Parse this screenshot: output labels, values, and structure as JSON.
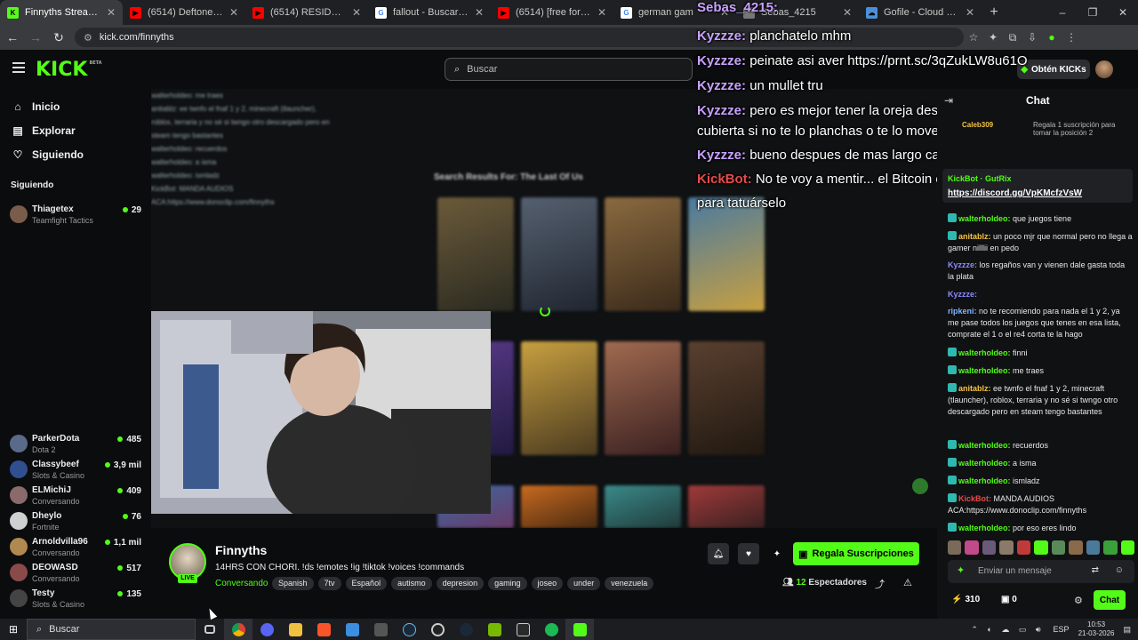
{
  "browser": {
    "tabs": [
      {
        "title": "Finnyths Stream - Watch L",
        "color": "#53fc18",
        "glyph": "K",
        "active": true
      },
      {
        "title": "(6514) Deftones – Risk (O",
        "color": "#ff0000",
        "glyph": "▶",
        "active": false
      },
      {
        "title": "(6514) RESIDENT EVIL RE",
        "color": "#ff0000",
        "glyph": "▶",
        "active": false
      },
      {
        "title": "fallout - Buscar con Goog",
        "color": "#ffffff",
        "glyph": "G",
        "active": false
      },
      {
        "title": "(6514) [free for profit] alt",
        "color": "#ff0000",
        "glyph": "▶",
        "active": false
      },
      {
        "title": "german gam",
        "color": "#ffffff",
        "glyph": "G",
        "active": false
      },
      {
        "title": "Sebas_4215",
        "color": "#777777",
        "glyph": "",
        "active": false
      },
      {
        "title": "Gofile - Cloud Storage M",
        "color": "#4a90d9",
        "glyph": "☁",
        "active": false
      }
    ],
    "url": "kick.com/finnyths"
  },
  "kick": {
    "logo": "KICK",
    "logo_badge": "BETA",
    "search_placeholder": "Buscar",
    "kicks_button": "Obtén KICKs"
  },
  "sidebar": {
    "nav": [
      {
        "label": "Inicio",
        "icon": "⌂"
      },
      {
        "label": "Explorar",
        "icon": "▤"
      },
      {
        "label": "Siguiendo",
        "icon": "♡"
      }
    ],
    "following_heading": "Siguiendo",
    "channels": [
      {
        "name": "Thiagetex",
        "category": "Teamfight Tactics",
        "viewers": "29",
        "color": "#7a5c4a"
      },
      {
        "name": "ParkerDota",
        "category": "Dota 2",
        "viewers": "485",
        "color": "#5a6a8a"
      },
      {
        "name": "Classybeef",
        "category": "Slots & Casino",
        "viewers": "3,9 mil",
        "color": "#2f4f8f"
      },
      {
        "name": "ELMichiJ",
        "category": "Conversando",
        "viewers": "409",
        "color": "#8a6a6a"
      },
      {
        "name": "Dheylo",
        "category": "Fortnite",
        "viewers": "76",
        "color": "#d0d0d0"
      },
      {
        "name": "Arnoldvilla96",
        "category": "Conversando",
        "viewers": "1,1 mil",
        "color": "#b08850"
      },
      {
        "name": "DEOWASD",
        "category": "Conversando",
        "viewers": "517",
        "color": "#8a4a4a"
      },
      {
        "name": "Testy",
        "category": "Slots & Casino",
        "viewers": "135",
        "color": "#444444"
      }
    ]
  },
  "video": {
    "shop_heading": "Search Results For: The Last Of Us",
    "blur_chat": [
      "walterholdeo: me traes",
      "anitablz: ee twnfo el fnaf 1 y 2, minecraft (tlauncher),",
      "roblox, terraria y no sé si twngo otro descargado pero en",
      "steam tengo bastantes",
      "walterholdeo: recuerdos",
      "walterholdeo: a isma",
      "walterholdeo: ismladz",
      "KickBot: MANDA AUDIOS",
      "ACA:https://www.donoclip.com/finnyths"
    ],
    "overlay_chat": [
      {
        "user": "Sebas_4215:",
        "text": ""
      },
      {
        "user": "Kyzzze:",
        "text": "planchatelo mhm"
      },
      {
        "user": "Kyzzze:",
        "text": "peinate asi aver https://prnt.sc/3qZukLW8u61O"
      },
      {
        "user": "Kyzzze:",
        "text": "un mullet tru"
      },
      {
        "user": "Kyzzze:",
        "text": "pero es mejor tener la oreja descubierta, asi"
      },
      {
        "user": "",
        "text": "cubierta si no te lo planchas o te lo moves ve raro"
      },
      {
        "user": "Kyzzze:",
        "text": "bueno despues de mas largo capaz q si"
      },
      {
        "user": "KickBot:",
        "text": "No te voy a mentir... el Bitcoin está"
      },
      {
        "user": "",
        "text": "para tatuárselo"
      }
    ]
  },
  "stream": {
    "live_label": "LIVE",
    "name": "Finnyths",
    "title": "14HRS CON CHORI. !ds !emotes !ig !tiktok !voices !commands",
    "category": "Conversando",
    "tags": [
      "Spanish",
      "7tv",
      "Español",
      "autismo",
      "depresion",
      "gaming",
      "joseo",
      "under",
      "venezuela"
    ],
    "gift_button": "Regala Suscripciones",
    "viewer_count": "12",
    "viewer_label": "Espectadores"
  },
  "chat": {
    "title": "Chat",
    "gift_prompt": "Regala 1 suscripción para tomar la posición 2",
    "gifter": "Caleb309",
    "pinned_by": "KickBot · GutRix",
    "pinned_link": "https://discord.gg/VpKMcfzVsW",
    "messages": [
      {
        "user": "walterholdeo:",
        "text": "que juegos tiene",
        "color": "#53fc18"
      },
      {
        "user": "anitablz:",
        "text": "un poco mjr que normal pero no llega a gamer nilllii en pedo",
        "color": "#f5c542"
      },
      {
        "user": "Kyzzze:",
        "text": "los regaños van y vienen dale gasta toda la plata",
        "color": "#8e8bff"
      },
      {
        "user": "Kyzzze:",
        "text": "",
        "color": "#8e8bff"
      },
      {
        "user": "ripkeni:",
        "text": "no te recomiendo para nada el 1 y 2, ya me pase todos los juegos que tenes en esa lista, comprate el 1 o el re4 corta te la hago",
        "color": "#7fb4ff"
      },
      {
        "user": "walterholdeo:",
        "text": "finni",
        "color": "#53fc18"
      },
      {
        "user": "walterholdeo:",
        "text": "me traes",
        "color": "#53fc18"
      },
      {
        "user": "anitablz:",
        "text": "ee twnfo el fnaf 1 y 2, minecraft (tlauncher), roblox, terraria y no sé si twngo otro descargado pero en steam tengo bastantes",
        "color": "#f5c542"
      },
      {
        "user": "walterholdeo:",
        "text": "recuerdos",
        "color": "#53fc18"
      },
      {
        "user": "walterholdeo:",
        "text": "a isma",
        "color": "#53fc18"
      },
      {
        "user": "walterholdeo:",
        "text": "ismladz",
        "color": "#53fc18"
      },
      {
        "user": "KickBot:",
        "text": "MANDA AUDIOS ACA:https://www.donoclip.com/finnyths",
        "color": "#e84a4a"
      },
      {
        "user": "walterholdeo:",
        "text": "por eso eres lindo",
        "color": "#53fc18"
      }
    ],
    "input_placeholder": "Enviar un mensaje",
    "points": "310",
    "other_count": "0",
    "chat_button": "Chat"
  },
  "taskbar": {
    "search_placeholder": "Buscar",
    "lang": "ESP",
    "time": "10:53",
    "date": "21-03-2026"
  },
  "colors": {
    "accent": "#53fc18",
    "bg": "#0b0c0d",
    "panel": "#101113"
  }
}
